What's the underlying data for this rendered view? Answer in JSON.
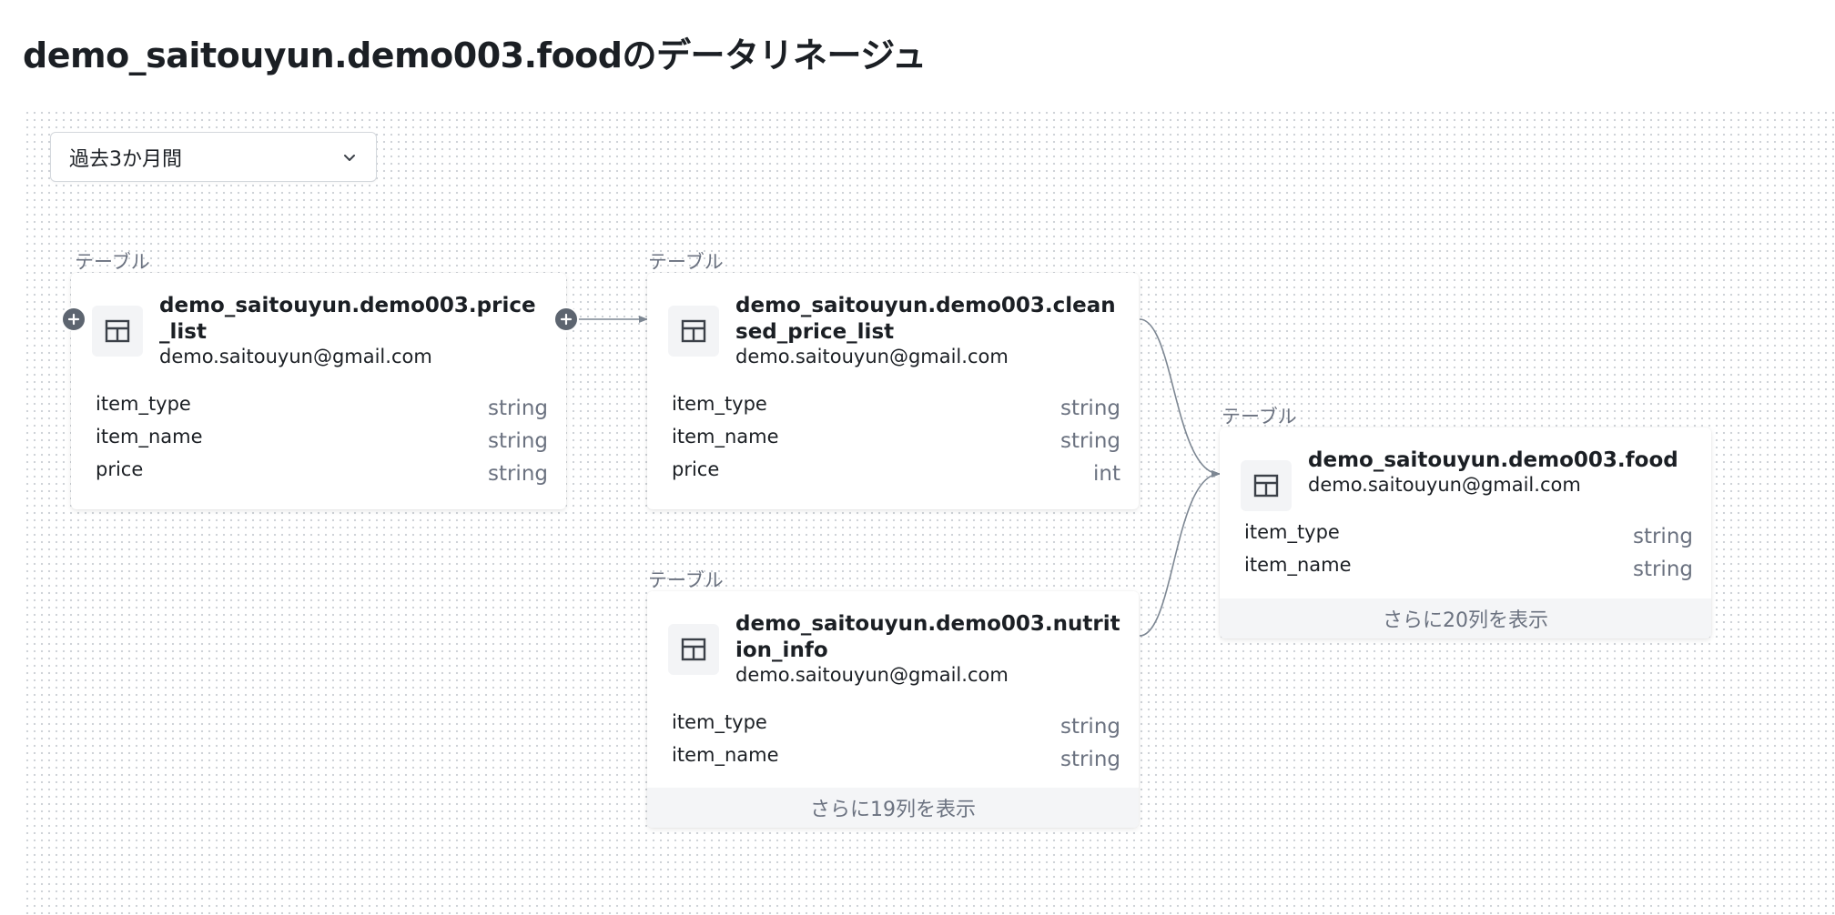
{
  "page": {
    "title": "demo_saitouyun.demo003.foodのデータリネージュ"
  },
  "filter": {
    "time_range": "過去3か月間"
  },
  "nodes": {
    "price_list": {
      "type_label": "テーブル",
      "name": "demo_saitouyun.demo003.price_list",
      "owner": "demo.saitouyun@gmail.com",
      "columns": [
        {
          "name": "item_type",
          "type": "string"
        },
        {
          "name": "item_name",
          "type": "string"
        },
        {
          "name": "price",
          "type": "string"
        }
      ]
    },
    "cleansed_price_list": {
      "type_label": "テーブル",
      "name": "demo_saitouyun.demo003.cleansed_price_list",
      "owner": "demo.saitouyun@gmail.com",
      "columns": [
        {
          "name": "item_type",
          "type": "string"
        },
        {
          "name": "item_name",
          "type": "string"
        },
        {
          "name": "price",
          "type": "int"
        }
      ]
    },
    "nutrition_info": {
      "type_label": "テーブル",
      "name": "demo_saitouyun.demo003.nutrition_info",
      "owner": "demo.saitouyun@gmail.com",
      "columns": [
        {
          "name": "item_type",
          "type": "string"
        },
        {
          "name": "item_name",
          "type": "string"
        }
      ],
      "more_label": "さらに19列を表示"
    },
    "food": {
      "type_label": "テーブル",
      "name": "demo_saitouyun.demo003.food",
      "owner": "demo.saitouyun@gmail.com",
      "columns": [
        {
          "name": "item_type",
          "type": "string"
        },
        {
          "name": "item_name",
          "type": "string"
        }
      ],
      "more_label": "さらに20列を表示"
    }
  },
  "icons": {
    "table": "table-icon",
    "expand": "plus-icon",
    "dropdown": "chevron-down-icon"
  },
  "colors": {
    "edge": "#7d8793",
    "expand_button": "#5d6570"
  }
}
